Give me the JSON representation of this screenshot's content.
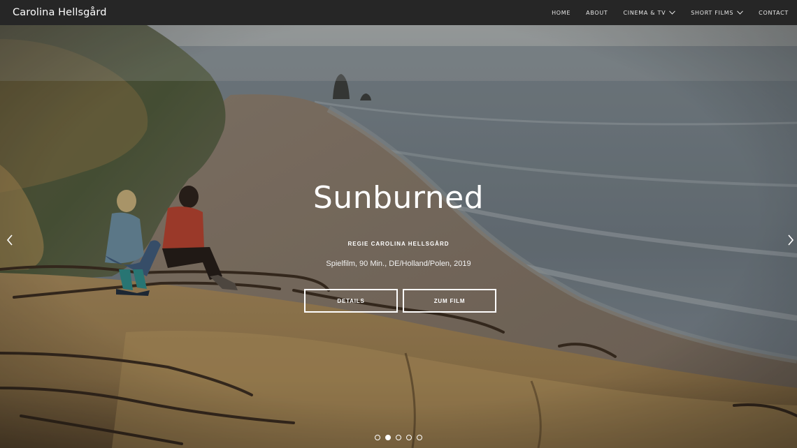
{
  "brand": "Carolina Hellsgård",
  "nav": {
    "items": [
      {
        "label": "HOME",
        "dropdown": false
      },
      {
        "label": "ABOUT",
        "dropdown": false
      },
      {
        "label": "CINEMA & TV",
        "dropdown": true
      },
      {
        "label": "SHORT FILMS",
        "dropdown": true
      },
      {
        "label": "CONTACT",
        "dropdown": false
      }
    ]
  },
  "slide": {
    "title": "Sunburned",
    "director": "REGIE CAROLINA HELLSGÅRD",
    "meta": "Spielfilm, 90 Min., DE/Holland/Polen, 2019",
    "buttons": {
      "details": "DETAILS",
      "film": "ZUM FILM"
    }
  },
  "slider": {
    "total_slides": 5,
    "active_slide": 2
  },
  "colors": {
    "navbar_bg": "#262626",
    "text": "#ffffff"
  },
  "icons": [
    "chevron-down-icon",
    "arrow-left-icon",
    "arrow-right-icon"
  ]
}
